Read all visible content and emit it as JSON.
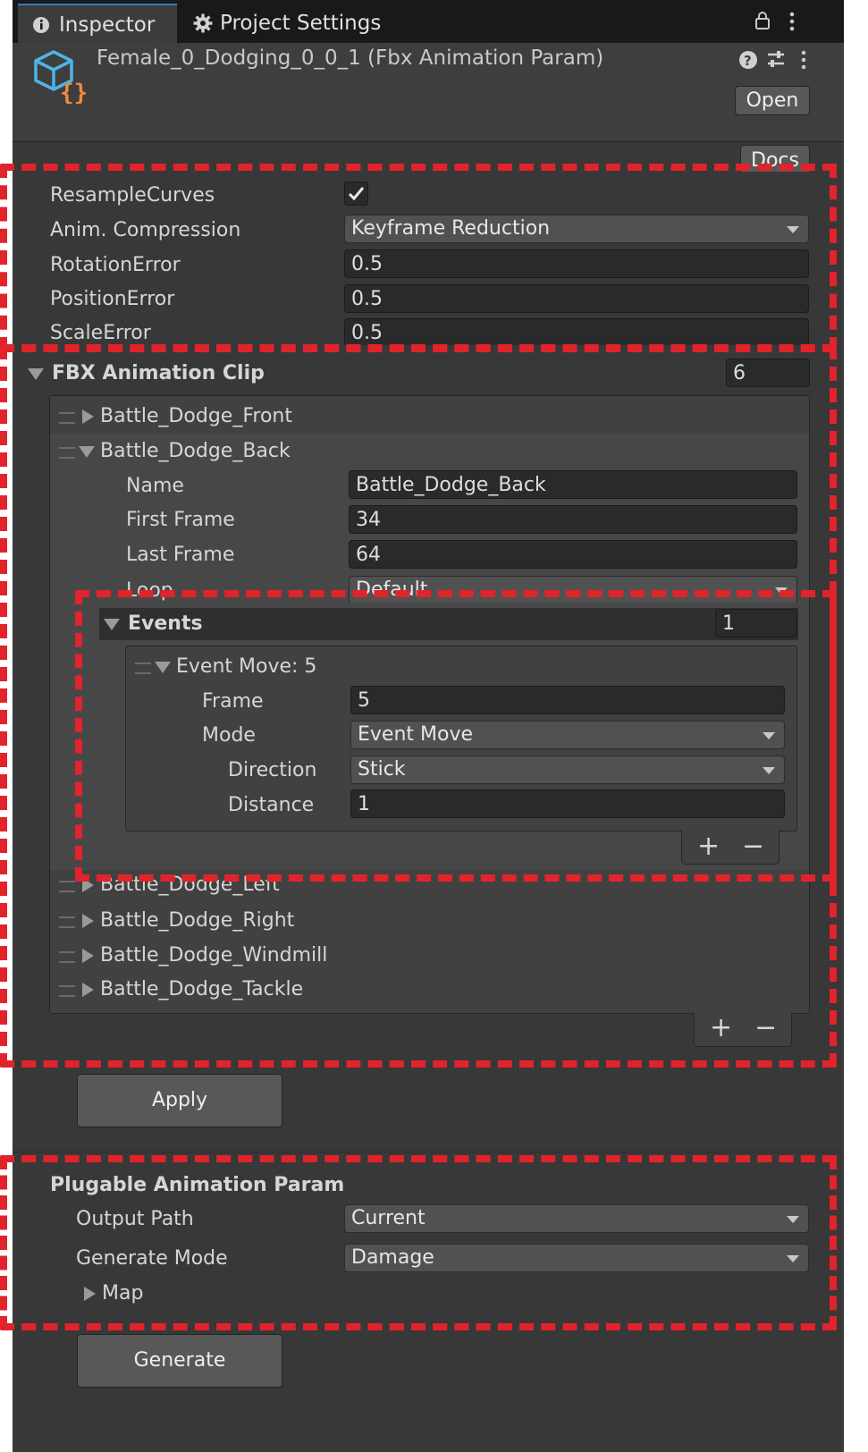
{
  "tabs": {
    "inspector": "Inspector",
    "project_settings": "Project Settings"
  },
  "header": {
    "title": "Female_0_Dodging_0_0_1 (Fbx Animation Param)",
    "open_label": "Open",
    "docs_label": "Docs"
  },
  "settings": {
    "resample_curves_label": "ResampleCurves",
    "resample_curves_checked": true,
    "anim_compression_label": "Anim. Compression",
    "anim_compression_value": "Keyframe Reduction",
    "rotation_error_label": "RotationError",
    "rotation_error_value": "0.5",
    "position_error_label": "PositionError",
    "position_error_value": "0.5",
    "scale_error_label": "ScaleError",
    "scale_error_value": "0.5"
  },
  "clips": {
    "title": "FBX Animation Clip",
    "count": "6",
    "items": [
      {
        "label": "Battle_Dodge_Front"
      },
      {
        "label": "Battle_Dodge_Back"
      },
      {
        "label": "Battle_Dodge_Left"
      },
      {
        "label": "Battle_Dodge_Right"
      },
      {
        "label": "Battle_Dodge_Windmill"
      },
      {
        "label": "Battle_Dodge_Tackle"
      }
    ],
    "expanded": {
      "name_label": "Name",
      "name_value": "Battle_Dodge_Back",
      "first_frame_label": "First Frame",
      "first_frame_value": "34",
      "last_frame_label": "Last Frame",
      "last_frame_value": "64",
      "loop_label": "Loop",
      "loop_value": "Default"
    }
  },
  "events": {
    "title": "Events",
    "count": "1",
    "event_title": "Event Move: 5",
    "frame_label": "Frame",
    "frame_value": "5",
    "mode_label": "Mode",
    "mode_value": "Event Move",
    "direction_label": "Direction",
    "direction_value": "Stick",
    "distance_label": "Distance",
    "distance_value": "1"
  },
  "apply_label": "Apply",
  "plugable": {
    "title": "Plugable Animation Param",
    "output_path_label": "Output Path",
    "output_path_value": "Current",
    "generate_mode_label": "Generate Mode",
    "generate_mode_value": "Damage",
    "map_label": "Map"
  },
  "generate_label": "Generate",
  "colors": {
    "panel_bg": "#383838",
    "highlight_red": "#e1232b",
    "asset_icon_blue": "#4fb3e8",
    "asset_icon_orange": "#f08a3c"
  }
}
